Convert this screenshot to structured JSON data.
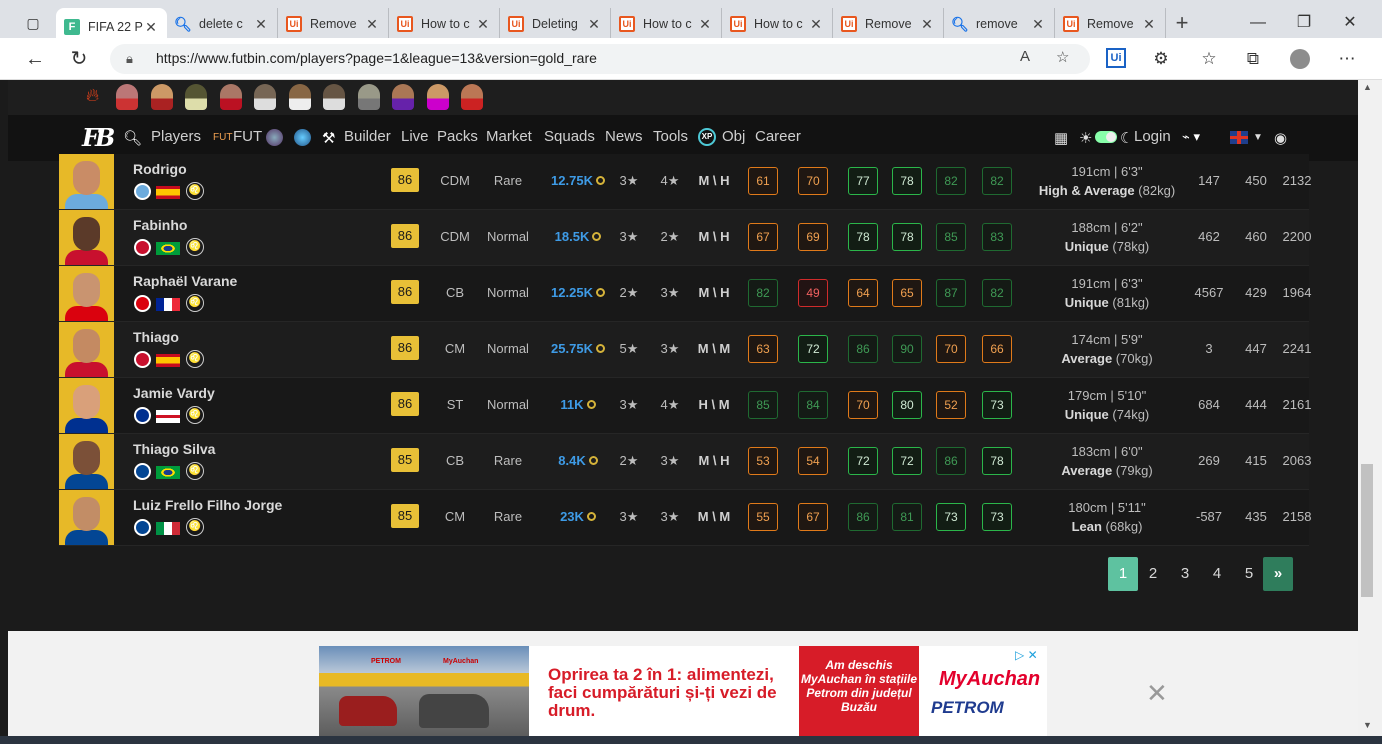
{
  "browser": {
    "tabs": [
      {
        "label": "FIFA 22 P",
        "favicon": "futbin-icon",
        "active": true
      },
      {
        "label": "delete c",
        "favicon": "search-icon"
      },
      {
        "label": "Remove",
        "favicon": "uipath-icon"
      },
      {
        "label": "How to c",
        "favicon": "uipath-icon"
      },
      {
        "label": "Deleting",
        "favicon": "uipath-icon"
      },
      {
        "label": "How to c",
        "favicon": "uipath-icon"
      },
      {
        "label": "How to c",
        "favicon": "uipath-icon"
      },
      {
        "label": "Remove",
        "favicon": "uipath-icon"
      },
      {
        "label": "remove",
        "favicon": "search-icon"
      },
      {
        "label": "Remove",
        "favicon": "uipath-icon"
      }
    ],
    "url": "https://www.futbin.com/players?page=1&league=13&version=gold_rare"
  },
  "site_nav": {
    "items": [
      "Players",
      "FUT",
      "Builder",
      "Live",
      "Packs",
      "Market",
      "Squads",
      "News",
      "Tools",
      "Obj",
      "Career"
    ],
    "login": "Login",
    "xp_badge": "XP"
  },
  "players": [
    {
      "name": "Rodrigo",
      "rating": "86",
      "position": "CDM",
      "version": "Rare",
      "price": "12.75K",
      "skills": "3★",
      "weak_foot": "4★",
      "work_rates": "M \\ H",
      "stats": [
        "61",
        "70",
        "77",
        "78",
        "82",
        "82"
      ],
      "stat_colors": [
        "orange",
        "orange",
        "green",
        "green",
        "dgreen",
        "dgreen"
      ],
      "height": "191cm | 6'3\"",
      "body_type": "High & Average",
      "weight": "(82kg)",
      "popularity": "147",
      "bs": "450",
      "igs": "2132",
      "club_color": "#6cabdd",
      "flag": [
        "#c60b1e",
        "#ffc400",
        "#c60b1e"
      ]
    },
    {
      "name": "Fabinho",
      "rating": "86",
      "position": "CDM",
      "version": "Normal",
      "price": "18.5K",
      "skills": "3★",
      "weak_foot": "2★",
      "work_rates": "M \\ H",
      "stats": [
        "67",
        "69",
        "78",
        "78",
        "85",
        "83"
      ],
      "stat_colors": [
        "orange",
        "orange",
        "green",
        "green",
        "dgreen",
        "dgreen"
      ],
      "height": "188cm | 6'2\"",
      "body_type": "Unique",
      "weight": "(78kg)",
      "popularity": "462",
      "bs": "460",
      "igs": "2200",
      "club_color": "#c8102e",
      "flag": [
        "#009c3b",
        "#ffdf00",
        "#009c3b"
      ]
    },
    {
      "name": "Raphaël Varane",
      "rating": "86",
      "position": "CB",
      "version": "Normal",
      "price": "12.25K",
      "skills": "2★",
      "weak_foot": "3★",
      "work_rates": "M \\ H",
      "stats": [
        "82",
        "49",
        "64",
        "65",
        "87",
        "82"
      ],
      "stat_colors": [
        "dgreen",
        "red",
        "orange",
        "orange",
        "dgreen",
        "dgreen"
      ],
      "height": "191cm | 6'3\"",
      "body_type": "Unique",
      "weight": "(81kg)",
      "popularity": "4567",
      "bs": "429",
      "igs": "1964",
      "club_color": "#da020e",
      "flag": [
        "#002395",
        "#ffffff",
        "#ed2939"
      ]
    },
    {
      "name": "Thiago",
      "rating": "86",
      "position": "CM",
      "version": "Normal",
      "price": "25.75K",
      "skills": "5★",
      "weak_foot": "3★",
      "work_rates": "M \\ M",
      "stats": [
        "63",
        "72",
        "86",
        "90",
        "70",
        "66"
      ],
      "stat_colors": [
        "orange",
        "green",
        "dgreen",
        "dgreen",
        "orange",
        "orange"
      ],
      "height": "174cm | 5'9\"",
      "body_type": "Average",
      "weight": "(70kg)",
      "popularity": "3",
      "bs": "447",
      "igs": "2241",
      "club_color": "#c8102e",
      "flag": [
        "#c60b1e",
        "#ffc400",
        "#c60b1e"
      ]
    },
    {
      "name": "Jamie Vardy",
      "rating": "86",
      "position": "ST",
      "version": "Normal",
      "price": "11K",
      "skills": "3★",
      "weak_foot": "4★",
      "work_rates": "H \\ M",
      "stats": [
        "85",
        "84",
        "70",
        "80",
        "52",
        "73"
      ],
      "stat_colors": [
        "dgreen",
        "dgreen",
        "orange",
        "green",
        "orange",
        "green"
      ],
      "height": "179cm | 5'10\"",
      "body_type": "Unique",
      "weight": "(74kg)",
      "popularity": "684",
      "bs": "444",
      "igs": "2161",
      "club_color": "#003090",
      "flag": [
        "#ffffff",
        "#ffffff",
        "#ffffff"
      ]
    },
    {
      "name": "Thiago Silva",
      "rating": "85",
      "position": "CB",
      "version": "Rare",
      "price": "8.4K",
      "skills": "2★",
      "weak_foot": "3★",
      "work_rates": "M \\ H",
      "stats": [
        "53",
        "54",
        "72",
        "72",
        "86",
        "78"
      ],
      "stat_colors": [
        "orange",
        "orange",
        "green",
        "green",
        "dgreen",
        "green"
      ],
      "height": "183cm | 6'0\"",
      "body_type": "Average",
      "weight": "(79kg)",
      "popularity": "269",
      "bs": "415",
      "igs": "2063",
      "club_color": "#034694",
      "flag": [
        "#009c3b",
        "#ffdf00",
        "#009c3b"
      ]
    },
    {
      "name": "Luiz Frello Filho Jorge",
      "rating": "85",
      "position": "CM",
      "version": "Rare",
      "price": "23K",
      "skills": "3★",
      "weak_foot": "3★",
      "work_rates": "M \\ M",
      "stats": [
        "55",
        "67",
        "86",
        "81",
        "73",
        "73"
      ],
      "stat_colors": [
        "orange",
        "orange",
        "dgreen",
        "dgreen",
        "green",
        "green"
      ],
      "height": "180cm | 5'11\"",
      "body_type": "Lean",
      "weight": "(68kg)",
      "popularity": "-587",
      "bs": "435",
      "igs": "2158",
      "club_color": "#034694",
      "flag": [
        "#009246",
        "#ffffff",
        "#ce2b37"
      ]
    }
  ],
  "pagination": {
    "pages": [
      "1",
      "2",
      "3",
      "4",
      "5"
    ],
    "next": "»",
    "current": "1"
  },
  "ad": {
    "headline": "Oprirea ta 2 în 1: alimentezi, faci cumpărături și-ți vezi de drum.",
    "side_text": "Am deschis MyAuchan în stațiile Petrom din județul Buzău",
    "brand1": "MyAuchan",
    "brand2": "PETROM",
    "photo_sign1": "PETROM",
    "photo_sign2": "MyAuchan"
  }
}
